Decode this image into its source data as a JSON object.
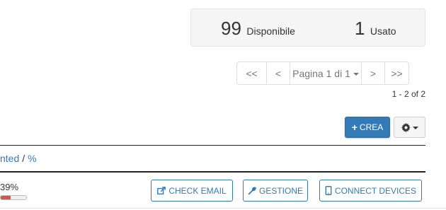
{
  "stats": {
    "available_count": "99",
    "available_label": "Disponibile",
    "used_count": "1",
    "used_label": "Usato"
  },
  "pagination": {
    "first": "<<",
    "prev": "<",
    "page_label": "Pagina 1 di 1",
    "next": ">",
    "last": ">>",
    "range": "1 - 2 of 2"
  },
  "toolbar": {
    "create_label": "CREA",
    "plus": "+"
  },
  "table_header": {
    "link_partial": "nted",
    "separator": "/",
    "percent": "%"
  },
  "row": {
    "usage_text": "39%",
    "usage_value": 0.39,
    "check_email_label": "CHECK EMAIL",
    "manage_label": "GESTIONE",
    "connect_label": "CONNECT DEVICES"
  },
  "icons": {
    "create": "plus-icon",
    "settings": "gear-icon",
    "email": "external-link-icon",
    "manage": "wrench-icon",
    "devices": "mobile-icon"
  },
  "colors": {
    "primary": "#337ab7",
    "danger": "#d9534f"
  }
}
